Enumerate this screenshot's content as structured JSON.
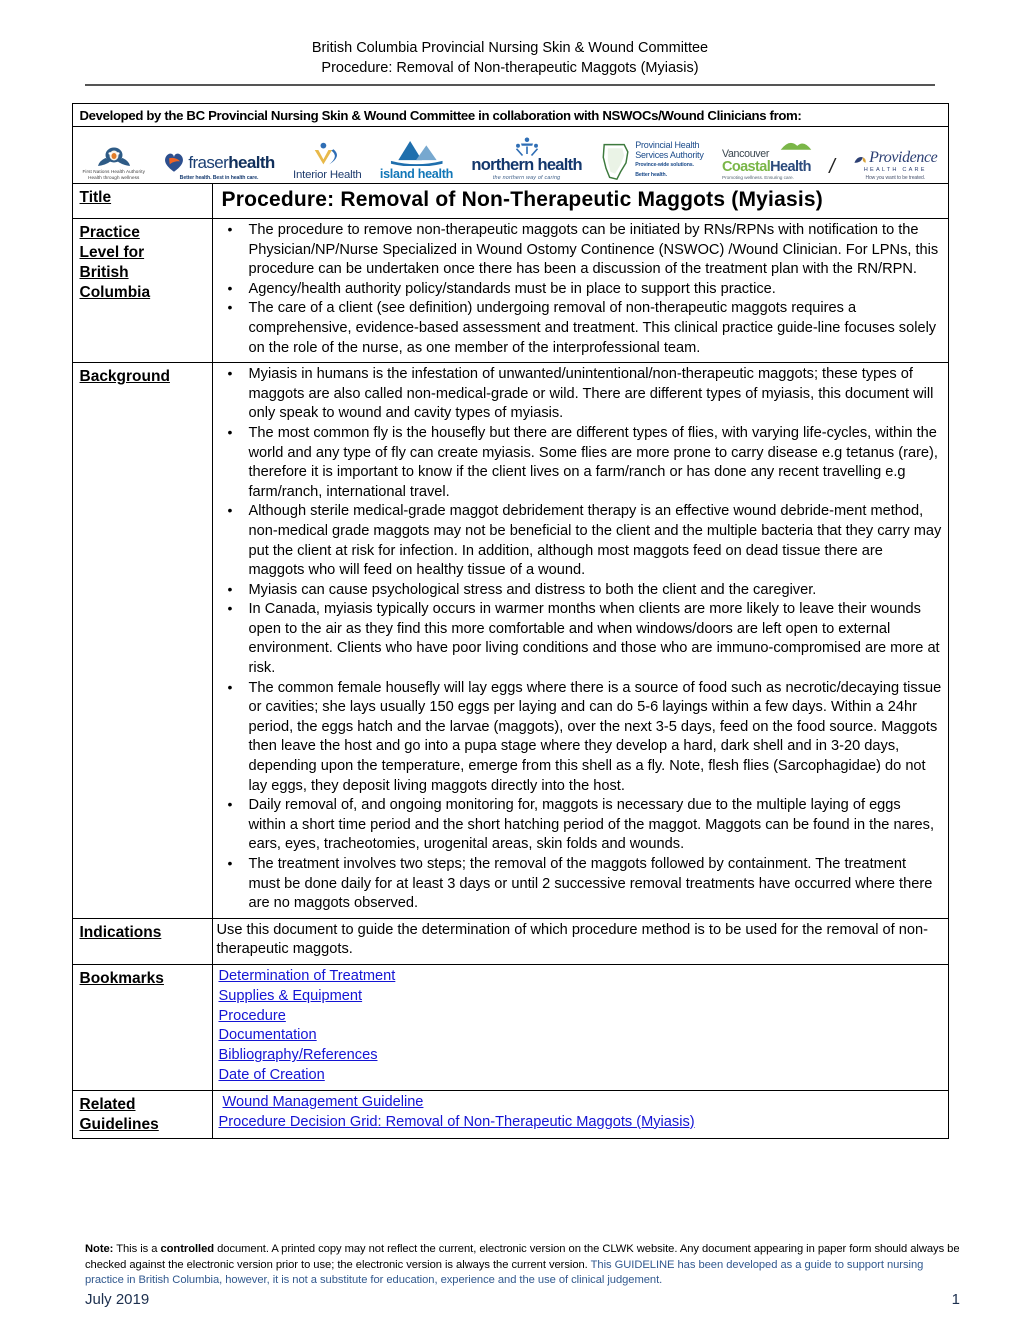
{
  "header": {
    "line1": "British Columbia Provincial Nursing Skin & Wound Committee",
    "line2": "Procedure: Removal of Non-therapeutic Maggots (Myiasis)"
  },
  "banner": {
    "text": "Developed by the BC Provincial Nursing Skin & Wound Committee in collaboration with NSWOCs/Wound Clinicians from:"
  },
  "logos": [
    {
      "name": "first-nations-health-authority",
      "line1": "First Nations Health Authority",
      "line2": "Health through wellness"
    },
    {
      "name": "fraser-health",
      "word_a": "fraser",
      "word_b": "health",
      "tagline": "Better health. Best in health care."
    },
    {
      "name": "interior-health",
      "word": "Interior Health"
    },
    {
      "name": "island-health",
      "word": "island health"
    },
    {
      "name": "northern-health",
      "word": "northern health",
      "tagline": "the northern way of caring"
    },
    {
      "name": "provincial-health-services-authority",
      "line1": "Provincial Health",
      "line2": "Services Authority",
      "line3": "Province-wide solutions.",
      "line4": "Better health."
    },
    {
      "name": "vancouver-coastal-health",
      "line1": "Vancouver",
      "word_a": "Coastal",
      "word_b": "Health",
      "tagline": "Promoting wellness. Ensuring care."
    },
    {
      "name": "providence-health-care",
      "word": "Providence",
      "line2": "HEALTH CARE",
      "tagline": "How you want to be treated."
    }
  ],
  "rows": {
    "title": {
      "label": "Title",
      "value": "Procedure: Removal of Non-Therapeutic Maggots (Myiasis)"
    },
    "practice_level": {
      "label_lines": [
        "Practice",
        "Level for",
        "British",
        "Columbia"
      ],
      "bullets": [
        "The procedure to remove non-therapeutic maggots can be initiated by RNs/RPNs with notification to the Physician/NP/Nurse Specialized in Wound Ostomy Continence (NSWOC) /Wound Clinician.  For LPNs, this procedure can be undertaken once there has been a discussion of the treatment plan with the RN/RPN.",
        "Agency/health authority policy/standards must be in place to support this practice.",
        "The care of a client (see definition) undergoing removal of non-therapeutic maggots requires a comprehensive, evidence-based assessment and treatment. This clinical practice guide-line focuses solely on the role of the nurse, as one member of the interprofessional team."
      ]
    },
    "background": {
      "label": "Background",
      "bullets": [
        "Myiasis in humans is the infestation of unwanted/unintentional/non-therapeutic maggots; these types of maggots are also called non-medical-grade or wild. There are different types of myiasis, this document will only speak to wound and cavity types of myiasis.",
        "The most common fly is the housefly but there are different types of flies, with varying life-cycles, within the world and any type of fly can create myiasis. Some flies are more prone to carry disease e.g tetanus (rare), therefore it is important to know if the client lives on a farm/ranch or has done any recent travelling e.g farm/ranch, international travel.",
        "Although sterile medical-grade maggot debridement therapy is an effective wound debride-ment method, non-medical grade maggots may not be beneficial to the client and the multiple bacteria that they carry may put the client at risk for infection. In addition, although most maggots feed on dead tissue there are maggots who will feed on healthy tissue of a wound.",
        "Myiasis can cause psychological stress and distress to both the client and the caregiver.",
        "In Canada, myiasis typically occurs in warmer months when clients are more likely to leave their wounds open to the air as they find this more comfortable and when windows/doors are left open to external environment. Clients who have poor living conditions and those who are immuno-compromised are more at risk.",
        "The common female housefly will lay eggs where there is a source of food such as necrotic/decaying tissue or cavities; she lays usually 150 eggs per laying and can do 5-6 layings within a few days. Within a 24hr period, the eggs hatch and the larvae (maggots), over the next 3-5 days, feed on the food source. Maggots then leave the host and go into a pupa stage where they develop a hard, dark shell and in 3-20 days, depending upon the temperature, emerge from this shell as a fly. Note, flesh flies (Sarcophagidae) do not lay eggs, they deposit living maggots directly into the host.",
        "Daily removal of, and ongoing monitoring for, maggots is necessary due to the multiple laying of eggs within a short time period and the short hatching period of the maggot. Maggots can be found in the nares, ears, eyes, tracheotomies, urogenital areas, skin folds and wounds.",
        "The treatment involves two steps; the removal of the maggots followed by containment. The treatment must be done daily for at least 3 days or until 2 successive removal treatments have occurred where there are no maggots observed."
      ]
    },
    "indications": {
      "label": "Indications",
      "text": "Use this document to guide the determination of which procedure method is to be used for the removal of non-therapeutic maggots."
    },
    "bookmarks": {
      "label": "Bookmarks",
      "links": [
        "Determination of Treatment",
        "Supplies & Equipment",
        "Procedure",
        "Documentation",
        "Bibliography/References",
        "Date of Creation"
      ]
    },
    "related_guidelines": {
      "label_lines": [
        "Related",
        "Guidelines"
      ],
      "links": [
        "Wound Management Guideline",
        "Procedure Decision Grid: Removal of Non-Therapeutic Maggots (Myiasis)"
      ]
    }
  },
  "footer": {
    "note_label": "Note:",
    "note_part1": " This is a ",
    "note_bold": "controlled",
    "note_part2": " document. A printed copy may not reflect the current, electronic version on the CLWK website.  Any document appearing in paper form should always be checked against the electronic version prior to use; the electronic version is always the current version. ",
    "note_blue": "This GUIDELINE has been developed as a guide to support nursing practice in British Columbia, however, it is not a substitute for education, experience and the use of clinical judgement.",
    "date": "July 2019",
    "page": "1"
  },
  "colors": {
    "link": "#1414d4",
    "footer_blue": "#31598f",
    "fraser_orange": "#ef6324",
    "island_blue": "#1277b8",
    "vch_green": "#7ab648"
  }
}
